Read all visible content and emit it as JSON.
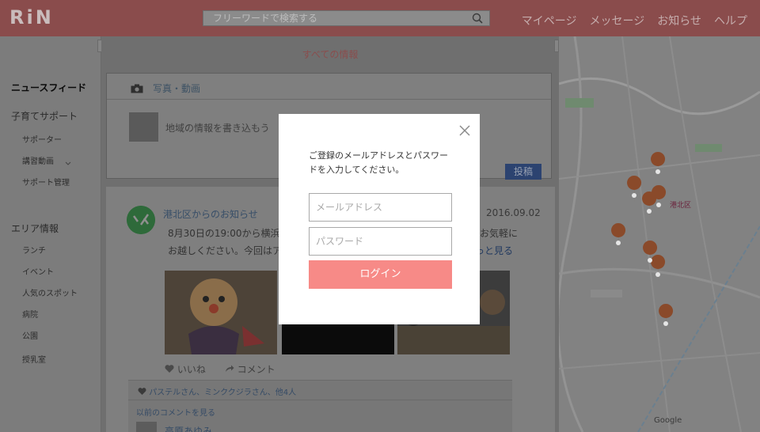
{
  "header": {
    "logo": "RiN",
    "search_placeholder": "フリーワードで検索する",
    "nav": [
      "マイページ",
      "メッセージ",
      "お知らせ",
      "ヘルプ"
    ],
    "bg_color": "#f08c8c"
  },
  "sidebar": {
    "news_feed": "ニュースフィード",
    "childcare": "子育てサポート",
    "childcare_items": [
      "サポーター",
      "講習動画",
      "サポート管理"
    ],
    "area": "エリア情報",
    "area_items": [
      "ランチ",
      "イベント",
      "人気のスポット",
      "病院",
      "公園",
      "授乳室"
    ]
  },
  "center": {
    "title": "すべての情報",
    "photo_tab": "写真・動画",
    "post_placeholder": "地域の情報を書き込もう",
    "post_button": "投稿"
  },
  "feed": {
    "source": "港北区からのお知らせ",
    "date": "2016.09.02",
    "text1": "8月30日の19:00から横浜駅",
    "text1_tail": "お気軽に",
    "text2": "お越しください。今回はア",
    "more": "っと見る",
    "like": "いいね",
    "comment": "コメント",
    "likes_line": "パステルさん、ミンククジラさん、他4人",
    "prev_comments": "以前のコメントを見る",
    "commenter": "高原あゆみ"
  },
  "map": {
    "area_label": "港北区",
    "google": "Google",
    "pin_color": "#ea6233"
  },
  "modal": {
    "message": "ご登録のメールアドレスとパスワードを入力してください。",
    "email_placeholder": "メールアドレス",
    "password_placeholder": "パスワード",
    "login_button": "ログイン",
    "button_color": "#f78a87"
  }
}
